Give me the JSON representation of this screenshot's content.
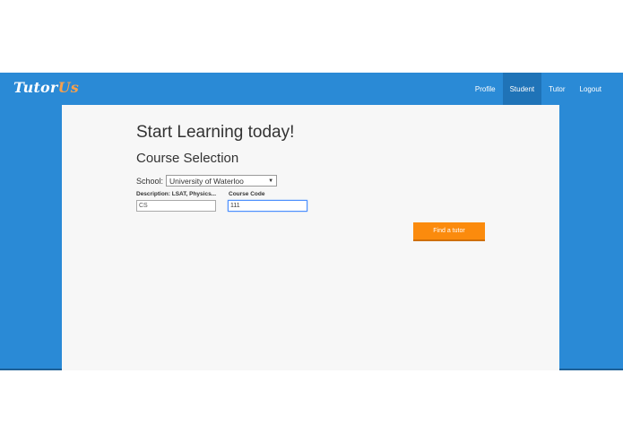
{
  "brand": {
    "logo_part1": "Tutor",
    "logo_part2": "Us",
    "primary_color": "#2a8ad6",
    "accent_color": "#fb8b0d"
  },
  "nav": {
    "items": [
      {
        "label": "Profile",
        "active": false
      },
      {
        "label": "Student",
        "active": true
      },
      {
        "label": "Tutor",
        "active": false
      },
      {
        "label": "Logout",
        "active": false
      }
    ]
  },
  "main": {
    "title": "Start Learning today!",
    "subtitle": "Course Selection",
    "school_label": "School:",
    "school_selected": "University of Waterloo",
    "description_label": "Description: LSAT, Physics...",
    "description_value": "CS",
    "course_code_label": "Course Code",
    "course_code_value": "111",
    "find_button_label": "Find a tutor"
  }
}
